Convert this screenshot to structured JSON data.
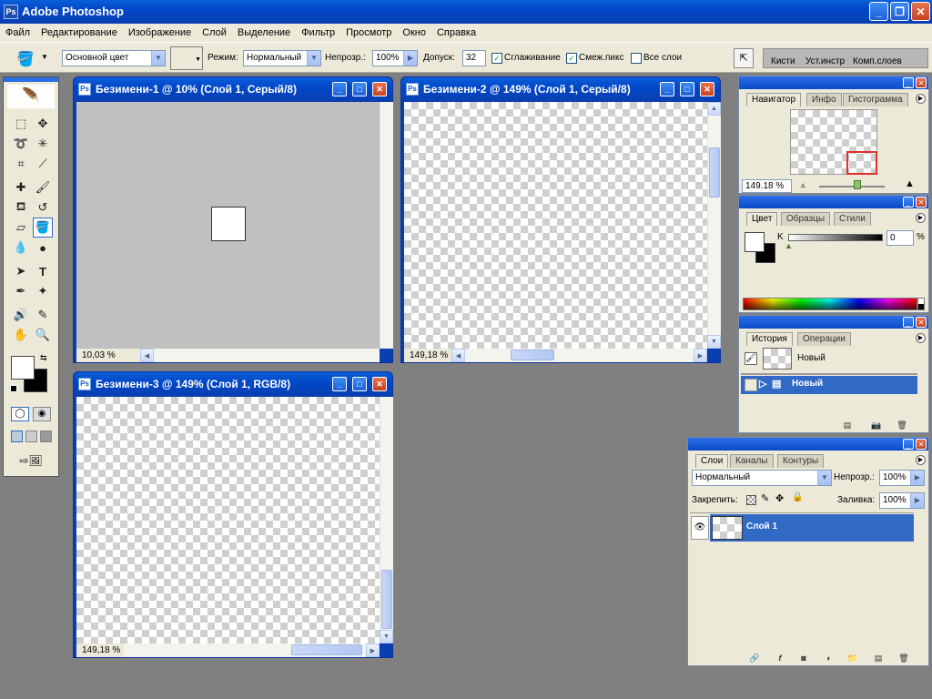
{
  "app": {
    "title": "Adobe Photoshop"
  },
  "menu": [
    "Файл",
    "Редактирование",
    "Изображение",
    "Слой",
    "Выделение",
    "Фильтр",
    "Просмотр",
    "Окно",
    "Справка"
  ],
  "options": {
    "fill_source": "Основной цвет",
    "mode_label": "Режим:",
    "mode_value": "Нормальный",
    "opacity_label": "Непрозр.:",
    "opacity_value": "100%",
    "tolerance_label": "Допуск:",
    "tolerance_value": "32",
    "antialias_label": "Сглаживание",
    "contiguous_label": "Смеж.пикс",
    "all_layers_label": "Все слои",
    "well_tabs": [
      "Кисти",
      "Уст.инстр",
      "Комп.слоев"
    ]
  },
  "documents": [
    {
      "title": "Безимени-1 @ 10% (Слой 1, Серый/8)",
      "zoom": "10,03 %"
    },
    {
      "title": "Безимени-2 @ 149% (Слой 1, Серый/8)",
      "zoom": "149,18 %"
    },
    {
      "title": "Безимени-3 @ 149% (Слой 1, RGB/8)",
      "zoom": "149,18 %"
    }
  ],
  "navigator": {
    "tabs": [
      "Навигатор",
      "Инфо",
      "Гистограмма"
    ],
    "zoom": "149.18 %"
  },
  "color": {
    "tabs": [
      "Цвет",
      "Образцы",
      "Стили"
    ],
    "channel_label": "K",
    "value": "0",
    "unit": "%"
  },
  "history": {
    "tabs": [
      "История",
      "Операции"
    ],
    "snapshot": "Новый",
    "state": "Новый"
  },
  "layers": {
    "tabs": [
      "Слои",
      "Каналы",
      "Контуры"
    ],
    "blend_mode": "Нормальный",
    "opacity_label": "Непрозр.:",
    "opacity_value": "100%",
    "lock_label": "Закрепить:",
    "fill_label": "Заливка:",
    "fill_value": "100%",
    "layer_name": "Слой 1"
  }
}
